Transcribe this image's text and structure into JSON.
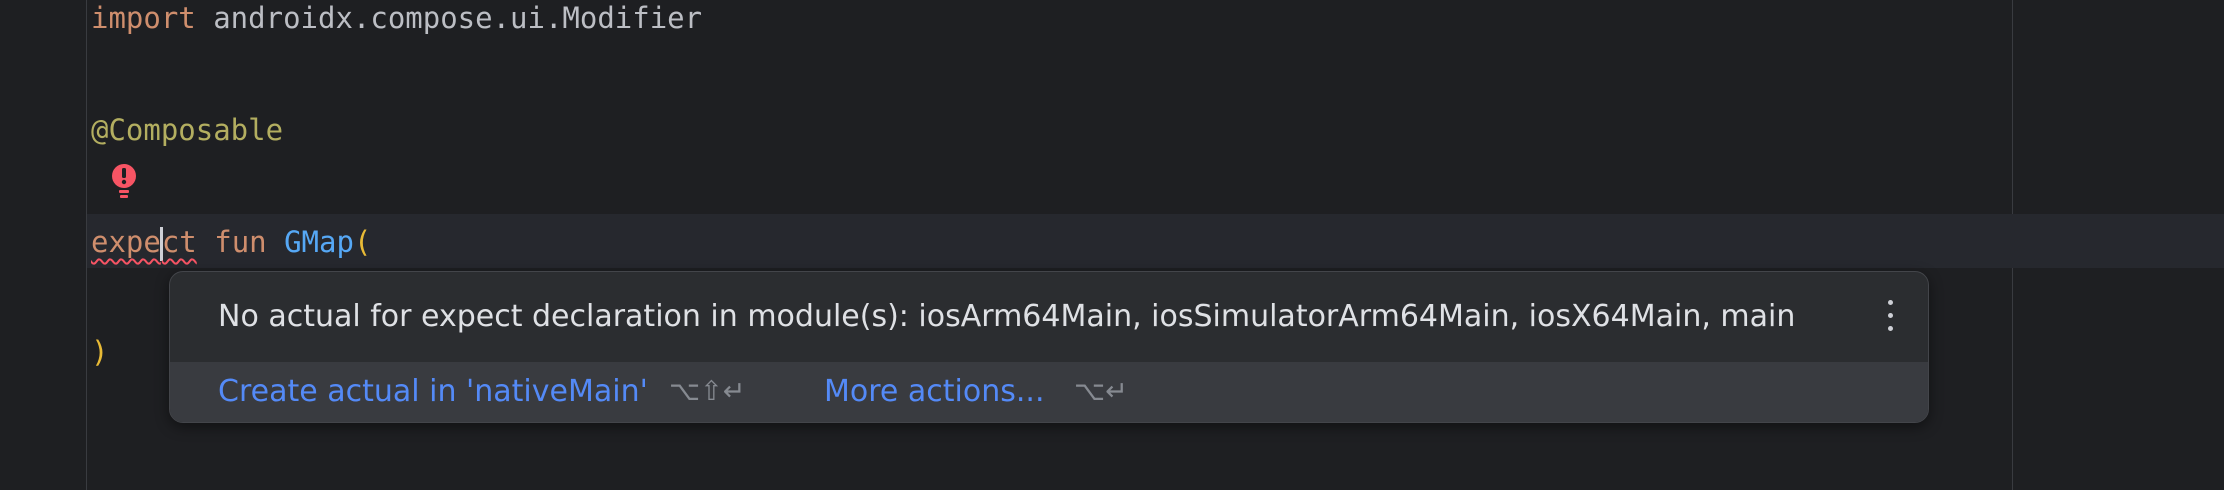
{
  "code": {
    "line1_keyword": "import",
    "line1_rest": " androidx.compose.ui.Modifier",
    "line3_annotation": "@Composable",
    "line5_kw_part1": "expe",
    "line5_kw_part2": "ct",
    "line5_fun": "fun",
    "line5_name": "GMap",
    "line5_paren": "(",
    "line7_paren": ")"
  },
  "gutter": {
    "error_icon": "error-bulb-icon"
  },
  "popup": {
    "message": "No actual for expect declaration in module(s): iosArm64Main, iosSimulatorArm64Main, iosX64Main, main",
    "menu_icon": "more-vertical-icon",
    "actions": [
      {
        "label": "Create actual in 'nativeMain'",
        "shortcut": "⌥⇧↵"
      },
      {
        "label": "More actions...",
        "shortcut": "⌥↵"
      }
    ]
  },
  "colors": {
    "background": "#1e1f22",
    "keyword": "#cf8e6d",
    "annotation": "#b3ae60",
    "function": "#56a8f5",
    "link": "#548af7",
    "error": "#f75464"
  }
}
